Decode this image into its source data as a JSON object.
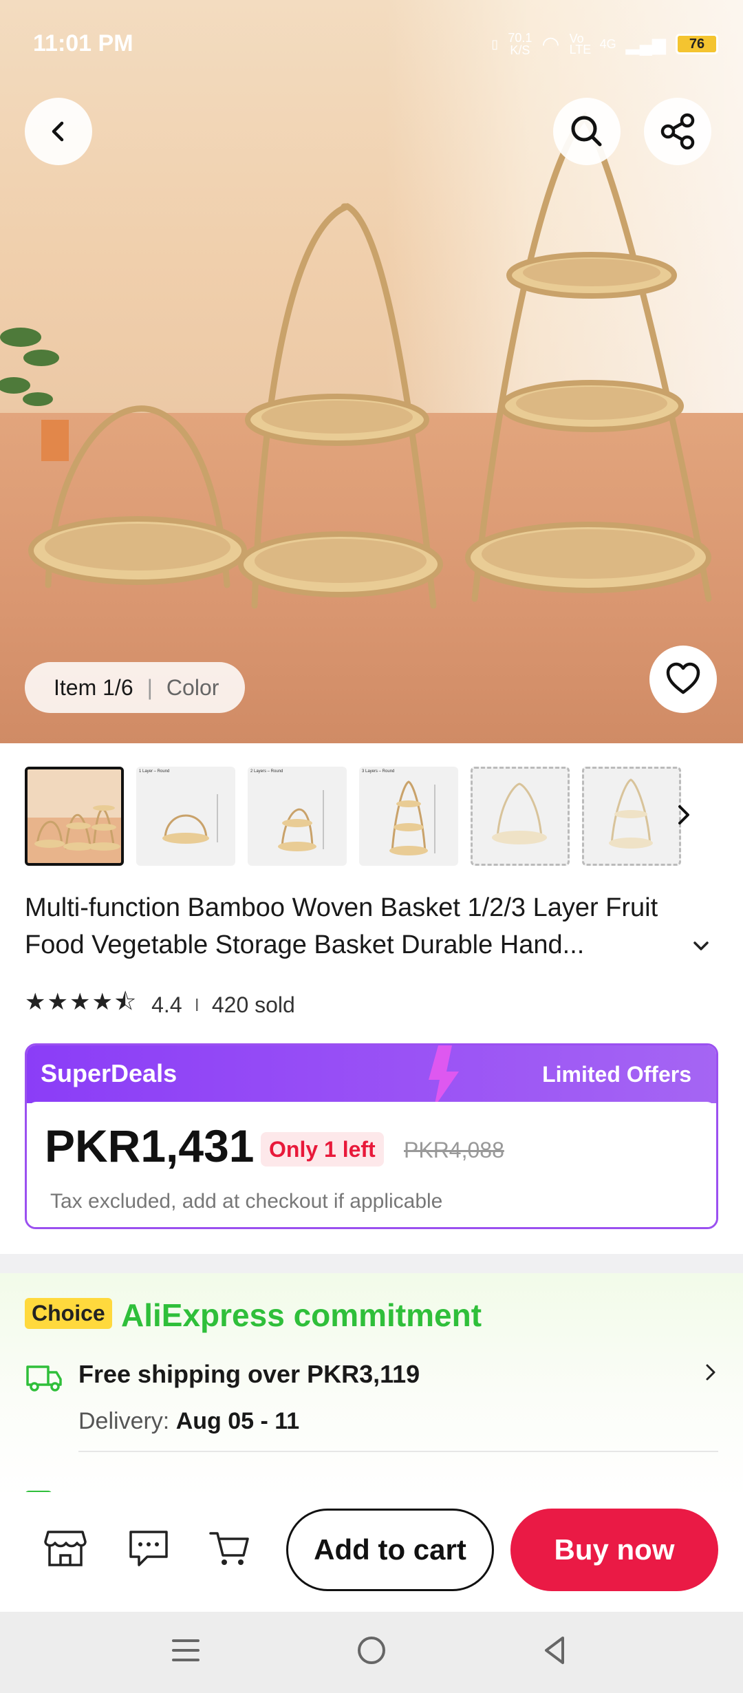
{
  "status_bar": {
    "time": "11:01 PM",
    "net_speed": "70.1",
    "net_unit": "K/S",
    "volte": "Vo LTE",
    "network": "4G",
    "battery": "76"
  },
  "gallery": {
    "item_label": "Item 1/6",
    "separator": "|",
    "variant_label": "Color",
    "thumbnails": [
      {
        "caption": ""
      },
      {
        "caption": "1 Layer – Round"
      },
      {
        "caption": "2 Layers – Round"
      },
      {
        "caption": "3 Layers – Round"
      },
      {
        "caption": ""
      },
      {
        "caption": ""
      }
    ]
  },
  "product": {
    "title": "Multi-function Bamboo Woven Basket 1/2/3 Layer Fruit Food Vegetable Storage Basket Durable Hand...",
    "rating": "4.4",
    "rating_value": 4.4,
    "rating_separator": "I",
    "sold": "420 sold"
  },
  "superdeals": {
    "brand": "SuperDeals",
    "tagline": "Limited Offers",
    "price": "PKR1,431",
    "stock_badge": "Only 1 left",
    "original_price": "PKR4,088",
    "tax_note": "Tax excluded, add at checkout if applicable"
  },
  "commitment": {
    "tag": "Choice",
    "title": "AliExpress commitment",
    "shipping_title": "Free shipping over PKR3,119",
    "delivery_label": "Delivery:",
    "delivery_dates": "Aug 05 - 11"
  },
  "actions": {
    "add_to_cart": "Add to cart",
    "buy_now": "Buy now"
  },
  "colors": {
    "accent_red": "#ea1a45",
    "superdeals_purple": "#9b50f0",
    "choice_green": "#2fbf3a",
    "choice_yellow": "#ffd93d"
  }
}
